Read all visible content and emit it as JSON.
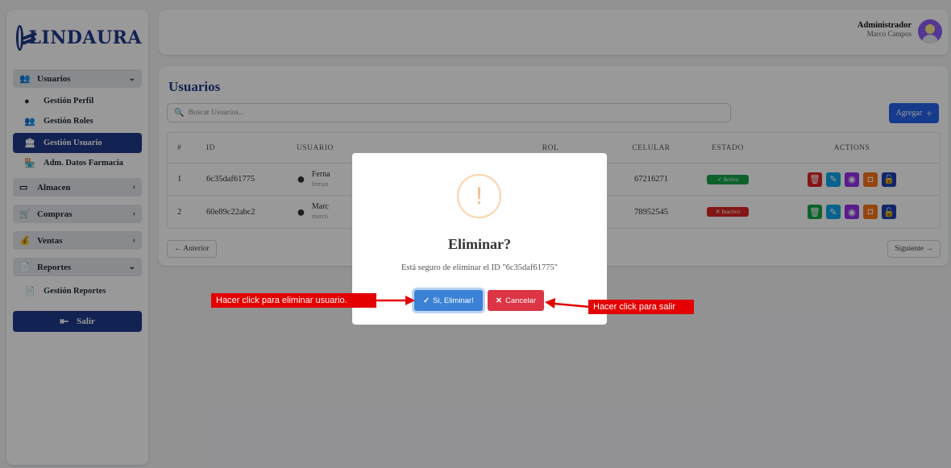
{
  "brand": {
    "name": "LINDAURA"
  },
  "sidebar": {
    "groups": [
      {
        "label": "Usuarios",
        "icon": "users-icon",
        "chevron": "⌄"
      },
      {
        "label": "Almacen",
        "icon": "warehouse-icon",
        "chevron": "‹"
      },
      {
        "label": "Compras",
        "icon": "cart-icon",
        "chevron": "‹"
      },
      {
        "label": "Ventas",
        "icon": "money-bag-icon",
        "chevron": "‹"
      },
      {
        "label": "Reportes",
        "icon": "report-icon",
        "chevron": "⌄"
      }
    ],
    "usuarios_items": [
      {
        "label": "Gestión Perfil"
      },
      {
        "label": "Gestión Roles"
      },
      {
        "label": "Gestión Usuario"
      },
      {
        "label": "Adm. Datos Farmacia"
      }
    ],
    "reportes_items": [
      {
        "label": "Gestión Reportes"
      }
    ],
    "logout_label": "Salir"
  },
  "header": {
    "role": "Administrador",
    "user": "Marco Campos"
  },
  "main": {
    "title": "Usuarios",
    "search_placeholder": "Buscar Usuarios...",
    "add_label": "Agregar",
    "columns": [
      "#",
      "ID",
      "USUARIO",
      "ROL",
      "CELULAR",
      "ESTADO",
      "ACTIONS"
    ],
    "rows": [
      {
        "num": "1",
        "id": "6c35daf61775",
        "name": "Ferna",
        "email": "fernan",
        "rol": "",
        "cel": "67216271",
        "estado": "✓ Activo"
      },
      {
        "num": "2",
        "id": "60e89c22abc2",
        "name": "Marc",
        "email": "marco",
        "rol": "",
        "cel": "78952545",
        "estado": "✕ Inactivo"
      }
    ],
    "prev_label": "← Anterior",
    "next_label": "Siguiente →"
  },
  "modal": {
    "icon": "!",
    "title": "Eliminar?",
    "text": "Está seguro de eliminar el ID \"6c35daf61775\"",
    "confirm_label": "Si, Eliminar!",
    "cancel_label": "Cancelar"
  },
  "annotations": {
    "left": "Hacer click para eliminar usuario.",
    "right": "Hacer click para salir"
  },
  "colors": {
    "brand": "#1e3a8a",
    "annotation": "#e40000",
    "confirm": "#3b82d6",
    "cancel": "#dc3545"
  }
}
